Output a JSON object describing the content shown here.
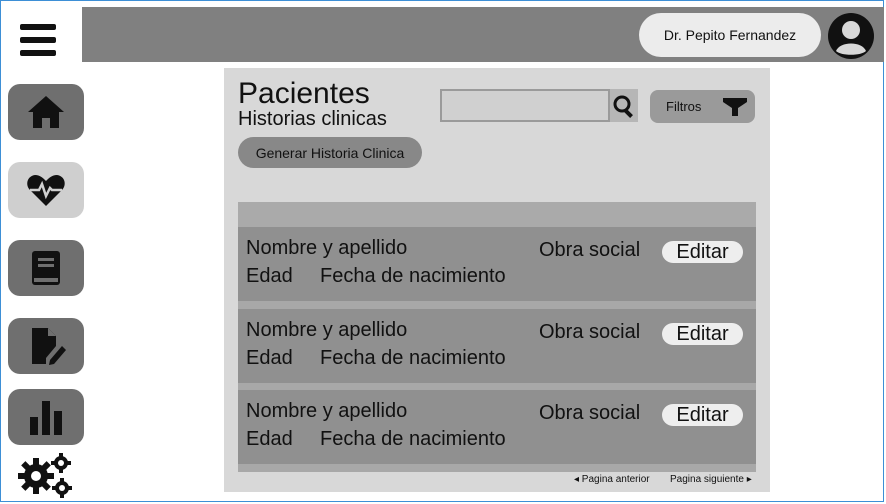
{
  "user": {
    "name": "Dr. Pepito Fernandez"
  },
  "header": {
    "title": "Pacientes",
    "subtitle": "Historias clinicas",
    "generate_button": "Generar Historia Clinica",
    "search": {
      "value": "",
      "placeholder": ""
    },
    "filter_label": "Filtros"
  },
  "sidebar": {
    "items": [
      {
        "icon": "home-icon"
      },
      {
        "icon": "heartbeat-icon",
        "active": true
      },
      {
        "icon": "book-icon"
      },
      {
        "icon": "edit-document-icon"
      },
      {
        "icon": "bar-chart-icon"
      },
      {
        "icon": "settings-gears-icon"
      }
    ]
  },
  "rows": [
    {
      "name": "Nombre y apellido",
      "insurance": "Obra social",
      "age": "Edad",
      "birth_date": "Fecha de nacimiento",
      "edit_label": "Editar"
    },
    {
      "name": "Nombre y apellido",
      "insurance": "Obra social",
      "age": "Edad",
      "birth_date": "Fecha de nacimiento",
      "edit_label": "Editar"
    },
    {
      "name": "Nombre y apellido",
      "insurance": "Obra social",
      "age": "Edad",
      "birth_date": "Fecha de nacimiento",
      "edit_label": "Editar"
    }
  ],
  "pagination": {
    "prev": "◂ Pagina anterior",
    "next": "Pagina siguiente ▸"
  },
  "colors": {
    "frame_border": "#3d8fd6",
    "topbar": "#808080",
    "panel": "#d8d8d8",
    "row": "#909090"
  }
}
